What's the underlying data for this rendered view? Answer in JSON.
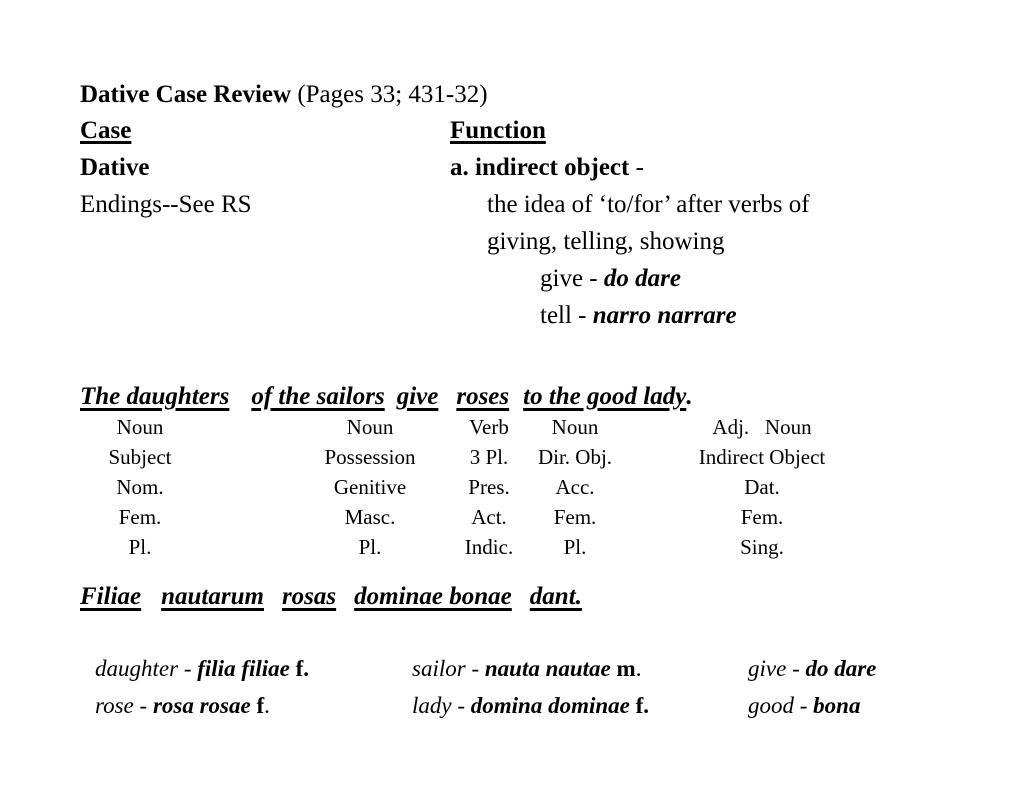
{
  "document": {
    "title_bold": "Dative Case Review",
    "title_pages": " (Pages 33; 431-32)"
  },
  "table_header": {
    "case": "Case",
    "function": "Function"
  },
  "case_rows": {
    "dative": "Dative",
    "indirect_object_bold": "a. indirect object",
    "indirect_object_dash": " -",
    "endings": "Endings--See RS",
    "idea_line": "the idea of ‘to/for’ after verbs of",
    "giving_line": "giving, telling, showing"
  },
  "verb_examples": [
    {
      "english": "give - ",
      "latin": "do dare"
    },
    {
      "english": "tell - ",
      "latin": "narro narrare"
    }
  ],
  "english_sentence": {
    "segments": [
      {
        "text": "The daughters",
        "gap": 22
      },
      {
        "text": "of the sailors",
        "gap": 12
      },
      {
        "text": "give",
        "gap": 18
      },
      {
        "text": "roses",
        "gap": 14
      },
      {
        "text": "to the good lady",
        "gap": 0
      }
    ],
    "final_punct": "."
  },
  "parse_grid": {
    "rows": [
      [
        "Noun",
        "Noun",
        "Verb",
        "Noun",
        "Adj.   Noun"
      ],
      [
        "Subject",
        "Possession",
        "3 Pl.",
        "Dir. Obj.",
        "Indirect Object"
      ],
      [
        "Nom.",
        "Genitive",
        "Pres.",
        "Acc.",
        "Dat."
      ],
      [
        "Fem.",
        "Masc.",
        "Act.",
        "Fem.",
        "Fem."
      ],
      [
        "Pl.",
        "Pl.",
        "Indic.",
        "Pl.",
        "Sing."
      ]
    ]
  },
  "latin_sentence": {
    "segments": [
      {
        "text": "Filiae",
        "gap": 20
      },
      {
        "text": "nautarum",
        "gap": 18
      },
      {
        "text": "rosas",
        "gap": 18
      },
      {
        "text": "dominae bonae",
        "gap": 18
      },
      {
        "text": "dant.",
        "gap": 0
      }
    ]
  },
  "vocabulary": {
    "rows": [
      [
        {
          "english": "daughter",
          "dash": " - ",
          "latin": "filia filiae",
          "gender": " f.",
          "gender_punct": ""
        },
        {
          "english": "sailor",
          "dash": " - ",
          "latin": "nauta nautae",
          "gender": " m",
          "gender_punct": "."
        },
        {
          "english": "give",
          "dash": " - ",
          "latin": "do dare",
          "gender": "",
          "gender_punct": ""
        }
      ],
      [
        {
          "english": "rose",
          "dash": " - ",
          "latin": "rosa rosae",
          "gender": " f",
          "gender_punct": "."
        },
        {
          "english": "lady",
          "dash": " - ",
          "latin": "domina dominae",
          "gender": " f.",
          "gender_punct": ""
        },
        {
          "english": "good",
          "dash": " - ",
          "latin": "bona",
          "gender": "",
          "gender_punct": ""
        }
      ]
    ]
  },
  "colors": {
    "background": "#ffffff",
    "text": "#000000"
  }
}
